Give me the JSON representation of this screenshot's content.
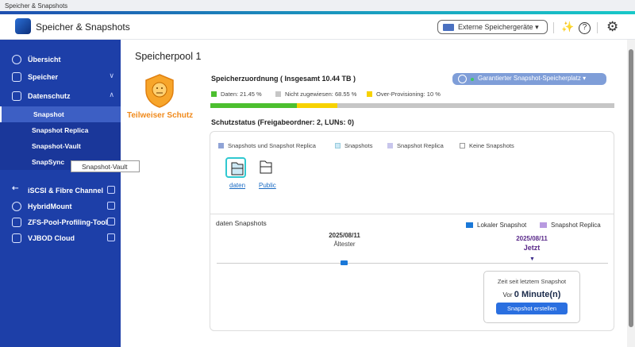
{
  "window": {
    "title": "Speicher & Snapshots"
  },
  "header": {
    "app_title": "Speicher & Snapshots",
    "external_devices": "Externe Speichergeräte"
  },
  "sidebar": {
    "items": [
      {
        "label": "Übersicht"
      },
      {
        "label": "Speicher"
      },
      {
        "label": "Datenschutz"
      },
      {
        "label": "iSCSI & Fibre Channel"
      },
      {
        "label": "HybridMount"
      },
      {
        "label": "ZFS-Pool-Profiling-Tool"
      },
      {
        "label": "VJBOD Cloud"
      }
    ],
    "subitems": [
      {
        "label": "Snapshot"
      },
      {
        "label": "Snapshot Replica"
      },
      {
        "label": "Snapshot-Vault"
      },
      {
        "label": "SnapSync"
      }
    ],
    "tooltip": "Snapshot-Vault"
  },
  "main": {
    "pool_title": "Speicherpool 1",
    "protection_status": "Teilweiser Schutz",
    "allocation_title": "Speicherzuordnung ( Insgesamt 10.44 TB )",
    "guaranteed_button": "Garantierter Snapshot-Speicherplatz",
    "legend": [
      {
        "label": "Daten: 21.45 %",
        "color": "#4cbf2f",
        "percent": 21.45
      },
      {
        "label": "Nicht zugewiesen: 68.55 %",
        "color": "#c6c6c6",
        "percent": 68.55
      },
      {
        "label": "Over-Provisioning: 10 %",
        "color": "#f7d200",
        "percent": 10
      }
    ],
    "status_title": "Schutzstatus (Freigabeordner: 2, LUNs: 0)",
    "status_legend": [
      "Snapshots und Snapshot Replica",
      "Snapshots",
      "Snapshot Replica",
      "Keine Snapshots"
    ],
    "folders": [
      {
        "name": "daten"
      },
      {
        "name": "Public"
      }
    ],
    "snapshots_title": "daten Snapshots",
    "timeline_legend": [
      "Lokaler Snapshot",
      "Snapshot Replica"
    ],
    "oldest_date": "2025/08/11",
    "oldest_label": "Ältester",
    "now_date": "2025/08/11",
    "now_label": "Jetzt",
    "popup": {
      "title": "Zeit seit letztem Snapshot",
      "prefix": "Vor",
      "value": "0 Minute(n)",
      "button": "Snapshot erstellen"
    }
  }
}
